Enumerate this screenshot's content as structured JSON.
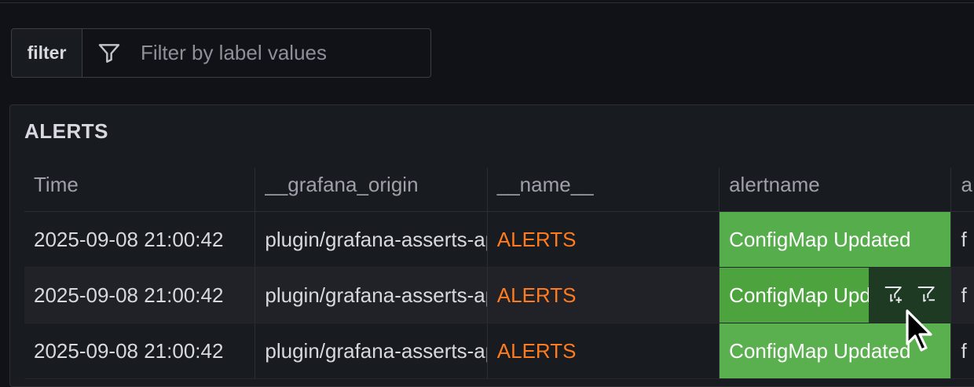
{
  "filter": {
    "label": "filter",
    "placeholder": "Filter by label values",
    "value": ""
  },
  "panel": {
    "title": "ALERTS"
  },
  "table": {
    "columns": [
      "Time",
      "__grafana_origin",
      "__name__",
      "alertname",
      "a"
    ],
    "rows": [
      {
        "time": "2025-09-08 21:00:42",
        "origin": "plugin/grafana-asserts-app",
        "name": "ALERTS",
        "alertname": "ConfigMap Updated",
        "extra": "f"
      },
      {
        "time": "2025-09-08 21:00:42",
        "origin": "plugin/grafana-asserts-app",
        "name": "ALERTS",
        "alertname": "ConfigMap Updated",
        "extra": "f"
      },
      {
        "time": "2025-09-08 21:00:42",
        "origin": "plugin/grafana-asserts-app",
        "name": "ALERTS",
        "alertname": "ConfigMap Updated",
        "extra": "f"
      }
    ]
  },
  "icons": {
    "filter": "filter-icon",
    "filter_for_value": "filter-plus-icon",
    "filter_out_value": "filter-minus-icon",
    "cursor": "mouse-pointer-icon"
  },
  "colors": {
    "background": "#111217",
    "panel": "#181b1f",
    "badge_green": "#56ad4b",
    "name_orange": "#ff7b1d"
  }
}
